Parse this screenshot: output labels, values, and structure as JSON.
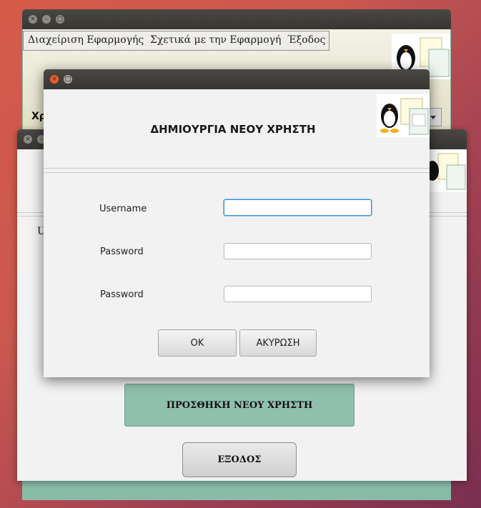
{
  "main_window": {
    "menu": [
      {
        "label": "Διαχείριση Εφαρμογής"
      },
      {
        "label": "Σχετικά με την Εφαρμογή"
      },
      {
        "label": "Έξοδος"
      }
    ],
    "partial_label": "Χρ"
  },
  "middle_window": {
    "partial_label": "U",
    "add_user_button": "ΠΡΟΣΘΗΚΗ ΝΕΟΥ ΧΡΗΣΤΗ",
    "exit_button": "ΕΞΟΔΟΣ"
  },
  "dialog": {
    "title": "ΔΗΜΙΟΥΡΓΙΑ ΝΕΟΥ ΧΡΗΣΤΗ",
    "fields": [
      {
        "label": "Username",
        "value": ""
      },
      {
        "label": "Password",
        "value": ""
      },
      {
        "label": "Password",
        "value": ""
      }
    ],
    "ok_button": "OK",
    "cancel_button": "ΑΚΥΡΩΣΗ"
  },
  "colors": {
    "accent_teal": "#8fc0ad",
    "focus_blue": "#3f8ed8",
    "close_orange": "#e95d2f"
  },
  "icons": [
    "tux-logo-icon",
    "close-icon",
    "minimize-icon",
    "maximize-icon",
    "dropdown-arrow-icon"
  ]
}
